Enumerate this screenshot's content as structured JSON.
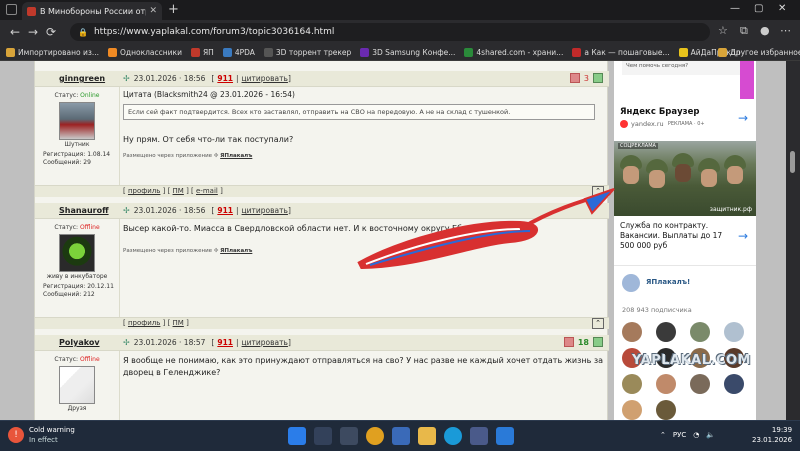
{
  "browser": {
    "tab_title": "В Минобороны России отреаги",
    "tab_close": "✕",
    "new_tab": "+",
    "url": "https://www.yaplakal.com/forum3/topic3036164.html",
    "bookmarks": [
      {
        "label": "Импортировано из...",
        "color": "#d8a43a"
      },
      {
        "label": "Одноклассники",
        "color": "#f08a24"
      },
      {
        "label": "ЯП",
        "color": "#c0392b"
      },
      {
        "label": "4PDA",
        "color": "#3a7ac0"
      },
      {
        "label": "3D торрент трекер",
        "color": "#555"
      },
      {
        "label": "3D Samsung Конфе...",
        "color": "#6a2ab0"
      },
      {
        "label": "4shared.com - храни...",
        "color": "#2a8a3a"
      },
      {
        "label": "а Как — пошаговые...",
        "color": "#c02a2a"
      },
      {
        "label": "АйДаПрикол",
        "color": "#e8c31c"
      }
    ],
    "other_bookmarks": "Другое избранное"
  },
  "posts": [
    {
      "username": "ginngreen",
      "date": "23.01.2026 · 18:56",
      "post_num": "911",
      "cite_label": "цитировать",
      "status_label": "Статус:",
      "status": "Online",
      "avatar_caption": "Шутник",
      "reg_label": "Регистрация:",
      "reg_date": "1.08.14",
      "msgs_label": "Сообщений:",
      "msgs": "29",
      "vote_minus": "",
      "vote_count": "3",
      "quote_head": "Цитата (Blacksmith24 @ 23.01.2026 - 16:54)",
      "quote_text": "Если сей факт подтвердится. Всех кто заставлял, отправить на СВО на передовую. А не на склад с тушенкой.",
      "text": "Ну прям. От себя что-ли так поступали?",
      "via": "Размещено через приложение",
      "via_app": "ЯПлакалъ",
      "footer": [
        "профиль",
        "ПМ",
        "e-mail"
      ]
    },
    {
      "username": "Shanauroff",
      "date": "23.01.2026 · 18:56",
      "post_num": "911",
      "cite_label": "цитировать",
      "status_label": "Статус:",
      "status": "Offline",
      "avatar_caption": "живу в инкубаторе",
      "reg_label": "Регистрация:",
      "reg_date": "20.12.11",
      "msgs_label": "Сообщений:",
      "msgs": "212",
      "text": "Высер какой-то. Миасса в Свердловской области нет. И к восточному округу Еб... отно... ...",
      "via": "Размещено через приложение",
      "via_app": "ЯПлакалъ",
      "footer": [
        "профиль",
        "ПМ"
      ]
    },
    {
      "username": "Polyakov",
      "date": "23.01.2026 · 18:57",
      "post_num": "911",
      "cite_label": "цитировать",
      "status_label": "Статус:",
      "status": "Offline",
      "avatar_caption": "Друзя",
      "vote_count": "18",
      "text": "Я вообще не понимаю, как это принуждают отправляться на сво? У нас разве не каждый хочет отдать жизнь за дворец в Геленджике?"
    }
  ],
  "sidebar": {
    "top_ad_text": "Чем помочь сегодня?",
    "yandex_title": "Яндекс Браузер",
    "yandex_domain": "yandex.ru",
    "yandex_ad": "РЕКЛАМА · 0+",
    "contract_badge": "СОЦРЕКЛАМА",
    "contract_domain": "защитник.рф",
    "contract_text": "Служба по контракту. Вакансии. Выплаты до 17 500 000 руб",
    "vk_name": "ЯПлакалъ!",
    "vk_subs": "208 943 подписчика"
  },
  "watermark": "YAPLAKAL.COM",
  "taskbar": {
    "weather_title": "Cold warning",
    "weather_sub": "In effect",
    "lang": "РУС",
    "time": "19:39",
    "date": "23.01.2026"
  }
}
